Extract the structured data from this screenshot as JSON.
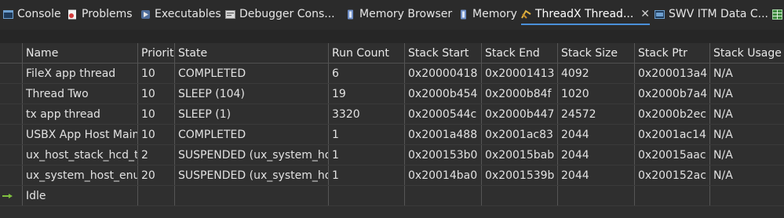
{
  "tabs": [
    {
      "label": "Console",
      "icon": "console-icon",
      "active": false
    },
    {
      "label": "Problems",
      "icon": "problems-icon",
      "active": false
    },
    {
      "label": "Executables",
      "icon": "executables-icon",
      "active": false
    },
    {
      "label": "Debugger Cons...",
      "icon": "debugger-console-icon",
      "active": false
    },
    {
      "label": "Memory Browser",
      "icon": "memory-browser-icon",
      "active": false
    },
    {
      "label": "Memory",
      "icon": "memory-icon",
      "active": false
    },
    {
      "label": "ThreadX Thread...",
      "icon": "threadx-icon",
      "active": true,
      "close": "✕"
    },
    {
      "label": "SWV ITM Data C...",
      "icon": "swv-icon",
      "active": false
    },
    {
      "label": "",
      "icon": "table-icon",
      "active": false
    }
  ],
  "colors": {
    "accent": "#4a90d9",
    "background": "#2f2f2f",
    "current_thread_arrow": "#7fbf3f"
  },
  "table": {
    "columns": [
      "",
      "Name",
      "Priority",
      "State",
      "Run Count",
      "Stack Start",
      "Stack End",
      "Stack Size",
      "Stack Ptr",
      "Stack Usage"
    ],
    "rows": [
      {
        "current": false,
        "cells": [
          "FileX app thread",
          "10",
          "COMPLETED",
          "6",
          "0x20000418",
          "0x20001413",
          "4092",
          "0x200013a4",
          "N/A"
        ]
      },
      {
        "current": false,
        "cells": [
          "Thread Two",
          "10",
          "SLEEP (104)",
          "19",
          "0x2000b454",
          "0x2000b84f",
          "1020",
          "0x2000b7a4",
          "N/A"
        ]
      },
      {
        "current": false,
        "cells": [
          "tx app thread",
          "10",
          "SLEEP (1)",
          "3320",
          "0x2000544c",
          "0x2000b447",
          "24572",
          "0x2000b2ec",
          "N/A"
        ]
      },
      {
        "current": false,
        "cells": [
          "USBX App Host Main",
          "10",
          "COMPLETED",
          "1",
          "0x2001a488",
          "0x2001ac83",
          "2044",
          "0x2001ac14",
          "N/A"
        ]
      },
      {
        "current": false,
        "cells": [
          "ux_host_stack_hcd_thread",
          "2",
          "SUSPENDED (ux_system_host_hcd_semaphore)",
          "1",
          "0x200153b0",
          "0x20015bab",
          "2044",
          "0x20015aac",
          "N/A"
        ]
      },
      {
        "current": false,
        "cells": [
          "ux_system_host_enum_thread",
          "20",
          "SUSPENDED (ux_system_host_enum_semaphore)",
          "1",
          "0x20014ba0",
          "0x2001539b",
          "2044",
          "0x200152ac",
          "N/A"
        ]
      },
      {
        "current": true,
        "cells": [
          "Idle",
          "",
          "",
          "",
          "",
          "",
          "",
          "",
          ""
        ]
      }
    ]
  }
}
